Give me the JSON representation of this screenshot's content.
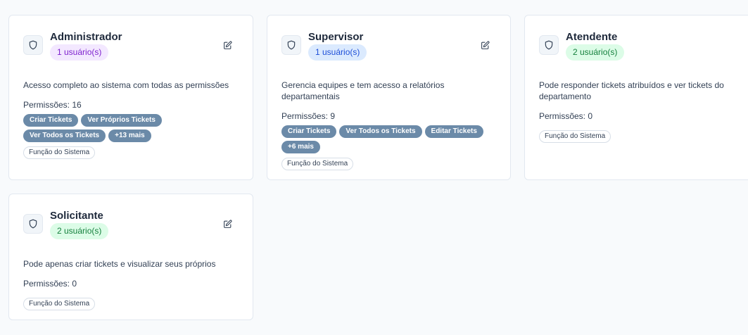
{
  "header": {
    "clipped_text": "... "
  },
  "cards": [
    {
      "title": "Administrador",
      "users": "1 usuário(s)",
      "description": "Acesso completo ao sistema com todas as permissões",
      "permissions_label": "Permissões: 16",
      "chips": [
        "Criar Tickets",
        "Ver Próprios Tickets",
        "Ver Todos os Tickets",
        "+13 mais"
      ],
      "system_badge": "Função do Sistema",
      "badge_color": "#f3e8ff"
    },
    {
      "title": "Supervisor",
      "users": "1 usuário(s)",
      "description": "Gerencia equipes e tem acesso a relatórios departamentais",
      "permissions_label": "Permissões: 9",
      "chips": [
        "Criar Tickets",
        "Ver Todos os Tickets",
        "Editar Tickets",
        "+6 mais"
      ],
      "system_badge": "Função do Sistema",
      "badge_color": "#dbeafe"
    },
    {
      "title": "Atendente",
      "users": "2 usuário(s)",
      "description": "Pode responder tickets atribuídos e ver tickets do departamento",
      "permissions_label": "Permissões: 0",
      "chips": [],
      "system_badge": "Função do Sistema",
      "badge_color": "#dcfce7"
    },
    {
      "title": "Solicitante",
      "users": "2 usuário(s)",
      "description": "Pode apenas criar tickets e visualizar seus próprios",
      "permissions_label": "Permissões: 0",
      "chips": [],
      "system_badge": "Função do Sistema",
      "badge_color": "#dcfce7"
    }
  ],
  "icons": {
    "role": "shield-icon",
    "edit": "edit-icon"
  }
}
